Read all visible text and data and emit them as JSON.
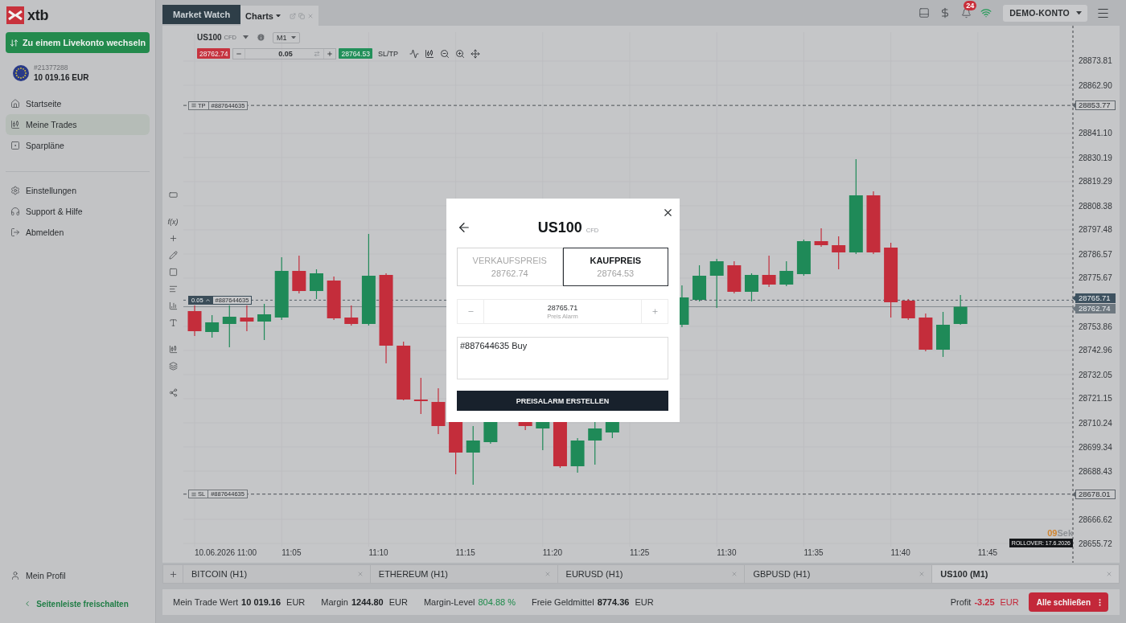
{
  "sidebar": {
    "logo": "xtb",
    "switch_button": "Zu einem Livekonto wechseln",
    "account": {
      "number": "#21377288",
      "balance": "10 019.16 EUR"
    },
    "nav_main": [
      {
        "label": "Startseite",
        "selected": false
      },
      {
        "label": "Meine Trades",
        "selected": true
      },
      {
        "label": "Sparpläne",
        "selected": false
      }
    ],
    "nav_secondary": [
      {
        "label": "Einstellungen",
        "selected": false
      },
      {
        "label": "Support & Hilfe",
        "selected": false
      },
      {
        "label": "Abmelden",
        "selected": false
      }
    ],
    "profile": "Mein Profil",
    "unlock_link": "Seitenleiste freischalten"
  },
  "top_bar": {
    "tabs": [
      {
        "label": "Market Watch",
        "selected": false
      },
      {
        "label": "Charts",
        "selected": true
      }
    ],
    "notifications_badge": "24",
    "account_menu": "DEMO-KONTO"
  },
  "chart": {
    "instrument": "US100",
    "instrument_type": "CFD",
    "timeframe": "M1",
    "sell_price": "28762.74",
    "volume": "0.05",
    "buy_price": "28764.53",
    "sltp_button": "SL/TP",
    "indicator_tool": "f(x)",
    "price_axis": [
      "28873.81",
      "28862.90",
      "28841.10",
      "28830.19",
      "28819.29",
      "28808.38",
      "28797.48",
      "28786.57",
      "28775.67",
      "28753.86",
      "28742.96",
      "28732.05",
      "28721.15",
      "28710.24",
      "28699.34",
      "28688.43",
      "28666.62",
      "28655.72"
    ],
    "time_axis": [
      "10.06.2026 11:00",
      "11:05",
      "11:10",
      "11:15",
      "11:20",
      "11:25",
      "11:30",
      "11:35",
      "11:40",
      "11:45"
    ],
    "order_lines": [
      {
        "kind": "take_profit",
        "badge": "TP",
        "order_id": "#887644635",
        "price": "28853.77"
      },
      {
        "kind": "position",
        "badge": "0.05",
        "order_id": "#887644635",
        "price": "28765.71"
      },
      {
        "kind": "bid",
        "price": "28762.74"
      },
      {
        "kind": "stop_loss",
        "badge": "SL",
        "order_id": "#887644635",
        "price": "28678.01"
      }
    ],
    "countdown": {
      "value": "09",
      "unit": "Sek"
    },
    "rollover": "ROLLOVER: 17.6.2026"
  },
  "chart_tabs": [
    {
      "label": "BITCOIN (H1)",
      "selected": false
    },
    {
      "label": "ETHEREUM (H1)",
      "selected": false
    },
    {
      "label": "EURUSD (H1)",
      "selected": false
    },
    {
      "label": "GBPUSD (H1)",
      "selected": false
    },
    {
      "label": "US100 (M1)",
      "selected": true
    }
  ],
  "status_bar": {
    "items": [
      {
        "kind": "amount",
        "label": "Mein Trade Wert",
        "value": "10 019.16",
        "unit": "EUR"
      },
      {
        "kind": "amount",
        "label": "Margin",
        "value": "1244.80",
        "unit": "EUR"
      },
      {
        "kind": "level",
        "label": "Margin-Level",
        "value": "804.88 %"
      },
      {
        "kind": "amount",
        "label": "Freie Geldmittel",
        "value": "8774.36",
        "unit": "EUR"
      }
    ],
    "profit": {
      "kind": "loss",
      "label": "Profit",
      "value": "-3.25",
      "unit": "EUR"
    },
    "close_all": "Alle schließen"
  },
  "dialog": {
    "title": "US100",
    "title_suffix": "CFD",
    "options": [
      {
        "label": "VERKAUFSPREIS",
        "price": "28762.74",
        "selected": false
      },
      {
        "label": "KAUFPREIS",
        "price": "28764.53",
        "selected": true
      }
    ],
    "alarm": {
      "value": "28765.71",
      "label": "Preis Alarm"
    },
    "note": "#887644635 Buy",
    "submit": "PREISALARM ERSTELLEN"
  }
}
